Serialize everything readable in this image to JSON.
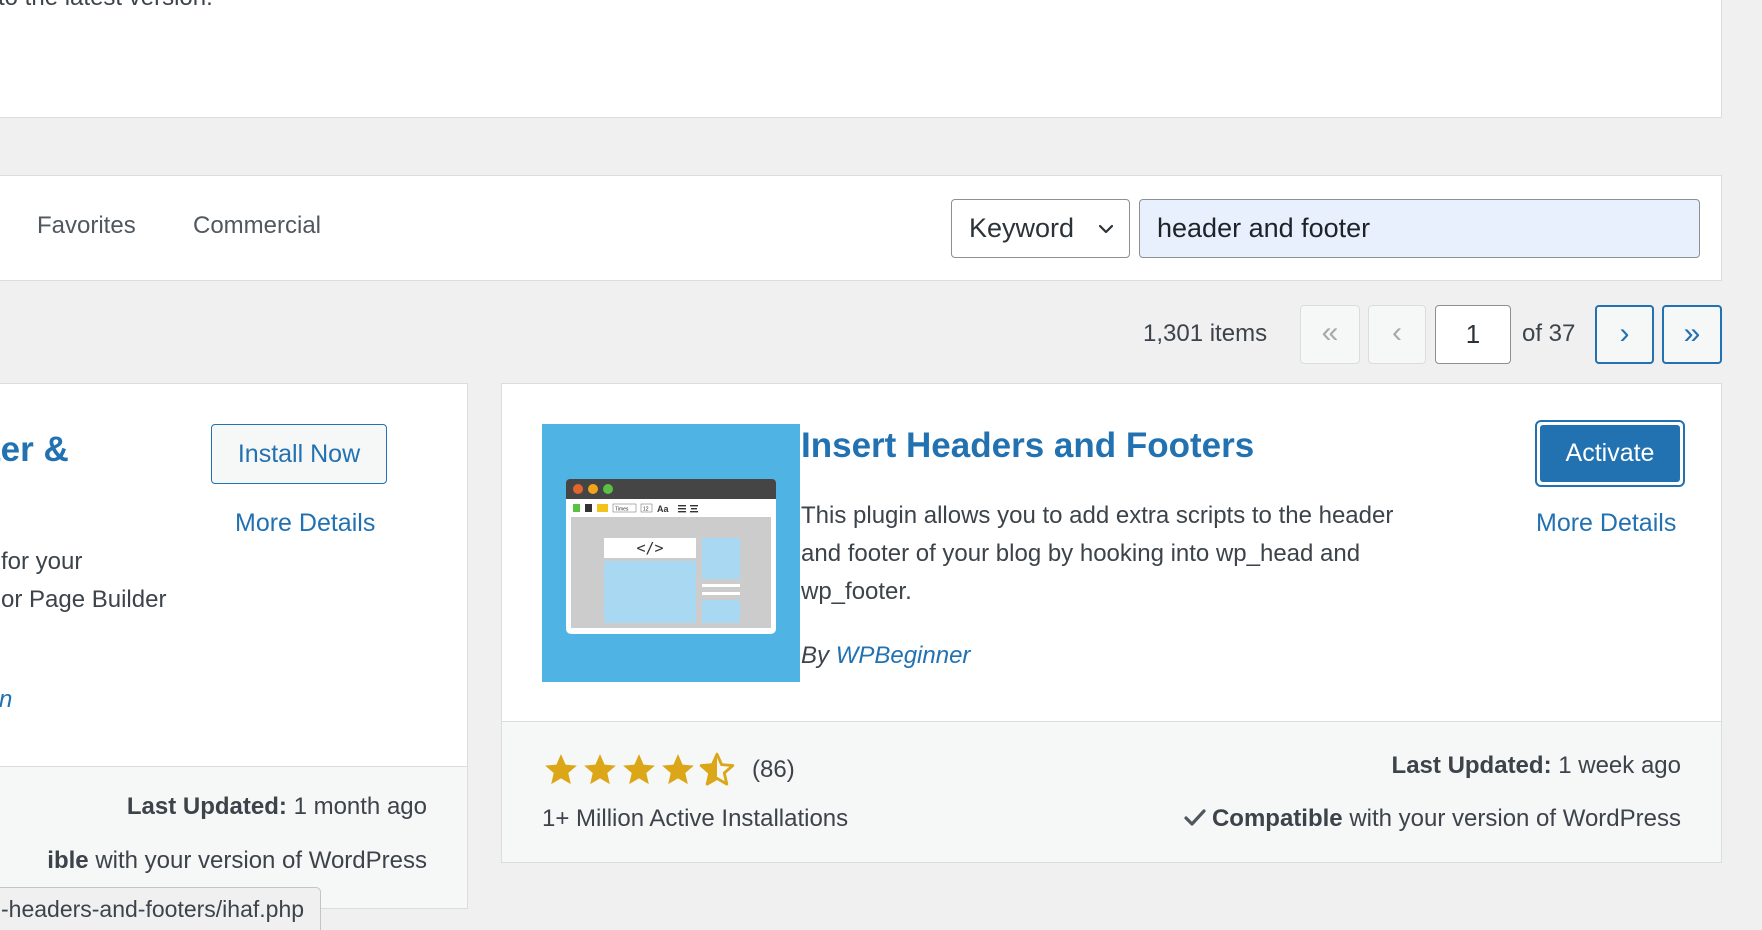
{
  "notice": {
    "text": "to the latest version."
  },
  "filter": {
    "tabs": [
      "Favorites",
      "Commercial"
    ],
    "search_type": "Keyword",
    "search_value": "header and footer"
  },
  "pagination": {
    "count": "1,301 items",
    "first": "«",
    "prev": "‹",
    "current": "1",
    "of": "of 37",
    "next": "›",
    "last": "»"
  },
  "plugins": [
    {
      "title_partial": "ter &",
      "install_label": "Install Now",
      "more_details": "More Details",
      "desc_line1": "for your",
      "desc_line2": "or Page Builder",
      "author_partial": "n",
      "last_updated_label": "Last Updated:",
      "last_updated_value": "1 month ago",
      "compat_bold": "ible",
      "compat_rest": "with your version of WordPress"
    },
    {
      "title": "Insert Headers and Footers",
      "activate_label": "Activate",
      "more_details": "More Details",
      "description": "This plugin allows you to add extra scripts to the header and footer of your blog by hooking into wp_head and wp_footer.",
      "by": "By",
      "author": "WPBeginner",
      "rating": 4.5,
      "rating_count": "(86)",
      "installs": "1+ Million Active Installations",
      "last_updated_label": "Last Updated:",
      "last_updated_value": "1 week ago",
      "compat_bold": "Compatible",
      "compat_rest": "with your version of WordPress",
      "icon_toolbar_font": "Times",
      "icon_toolbar_size": "12",
      "icon_toolbar_aa": "Aa",
      "icon_code": "</>"
    }
  ],
  "status_bar": {
    "url": "-headers-and-footers/ihaf.php"
  },
  "colors": {
    "accent": "#2271b1",
    "star": "#dba617",
    "icon_bg": "#4fb3e4"
  }
}
